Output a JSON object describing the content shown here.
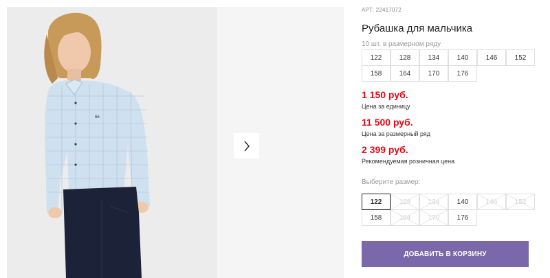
{
  "product": {
    "article": "АРТ: 22417072",
    "title": "Рубашка для мальчика",
    "pack_note": "10 шт. в размерном ряду"
  },
  "size_row": [
    "122",
    "128",
    "134",
    "140",
    "146",
    "152",
    "158",
    "164",
    "170",
    "176"
  ],
  "prices": [
    {
      "value": "1 150 руб.",
      "label": "Цена за единицу"
    },
    {
      "value": "11 500 руб.",
      "label": "Цена за размерный ряд"
    },
    {
      "value": "2 399 руб.",
      "label": "Рекомендуемая розничная цена"
    }
  ],
  "size_picker": {
    "label": "Выберите размер:",
    "options": [
      {
        "size": "122",
        "available": true,
        "selected": true
      },
      {
        "size": "128",
        "available": false,
        "selected": false
      },
      {
        "size": "134",
        "available": false,
        "selected": false
      },
      {
        "size": "140",
        "available": true,
        "selected": false
      },
      {
        "size": "146",
        "available": false,
        "selected": false
      },
      {
        "size": "152",
        "available": false,
        "selected": false
      },
      {
        "size": "158",
        "available": true,
        "selected": false
      },
      {
        "size": "164",
        "available": false,
        "selected": false
      },
      {
        "size": "170",
        "available": false,
        "selected": false
      },
      {
        "size": "176",
        "available": true,
        "selected": false
      }
    ]
  },
  "cart_button": "ДОБАВИТЬ В КОРЗИНУ",
  "gallery": {
    "next_icon": "chevron-right-icon"
  },
  "colors": {
    "price": "#e30613",
    "button": "#7b68ab"
  }
}
